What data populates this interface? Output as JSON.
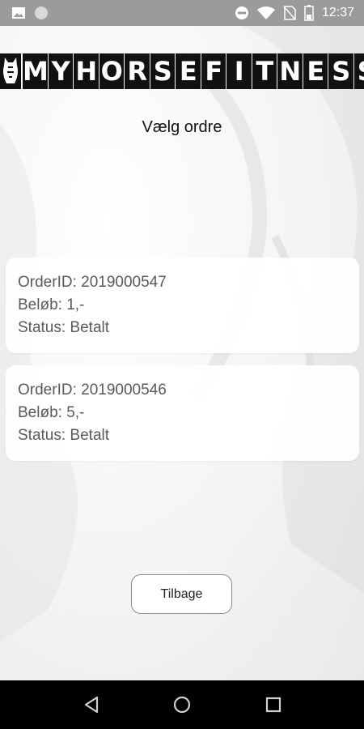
{
  "status_bar": {
    "time": "12:37",
    "left_icons": [
      "image-notification-icon",
      "circle-notification-icon"
    ],
    "right_icons": [
      "do-not-disturb-icon",
      "wifi-icon",
      "no-sim-icon",
      "battery-icon"
    ]
  },
  "app": {
    "logo_text": "MYHORSEFITNESS",
    "logo_letters": [
      "M",
      "Y",
      "H",
      "O",
      "R",
      "S",
      "E",
      "F",
      "I",
      "T",
      "N",
      "E",
      "S",
      "S"
    ],
    "page_title": "Vælg ordre",
    "orders": [
      {
        "order_id": "OrderID: 2019000547",
        "amount": "Beløb: 1,-",
        "status": "Status: Betalt"
      },
      {
        "order_id": "OrderID: 2019000546",
        "amount": "Beløb: 5,-",
        "status": "Status: Betalt"
      }
    ],
    "back_label": "Tilbage"
  },
  "nav_bar": {
    "buttons": [
      "back-nav-icon",
      "home-nav-icon",
      "recents-nav-icon"
    ]
  },
  "colors": {
    "status_bar": "#9b9b9b",
    "nav_bar": "#000000",
    "logo_block": "#111111",
    "card_text": "#5a5a5a"
  }
}
